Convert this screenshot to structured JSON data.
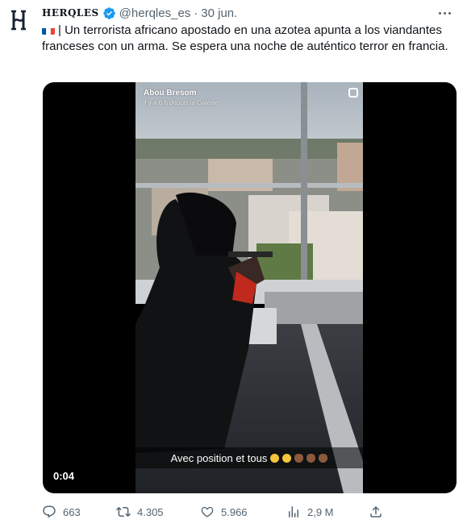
{
  "tweet": {
    "display_name": "HERQLES",
    "handle": "@herqles_es",
    "separator": "·",
    "date": "30 jun.",
    "text": "| Un terrorista africano apostado en una azotea apunta a los viandantes franceses con un arma. Se espera una noche de auténtico terror en francia.",
    "flag_colors": [
      "#0055a4",
      "#ffffff",
      "#ef4135"
    ]
  },
  "video": {
    "overlay_title": "Abou Bresom",
    "overlay_subtitle": "il y a 6 h depuis la Galerie",
    "caption": "Avec position et tous",
    "timecode": "0:04"
  },
  "actions": {
    "replies": "663",
    "retweets": "4.305",
    "likes": "5.966",
    "views": "2,9 M"
  },
  "icons": {
    "avatar": "herqles-logo-icon",
    "verified": "verified-badge-icon",
    "more": "more-options-icon",
    "reply": "reply-icon",
    "retweet": "retweet-icon",
    "like": "heart-icon",
    "views": "views-icon",
    "share": "share-icon"
  },
  "colors": {
    "text": "#0f1419",
    "muted": "#536471",
    "verified": "#1d9bf0"
  }
}
